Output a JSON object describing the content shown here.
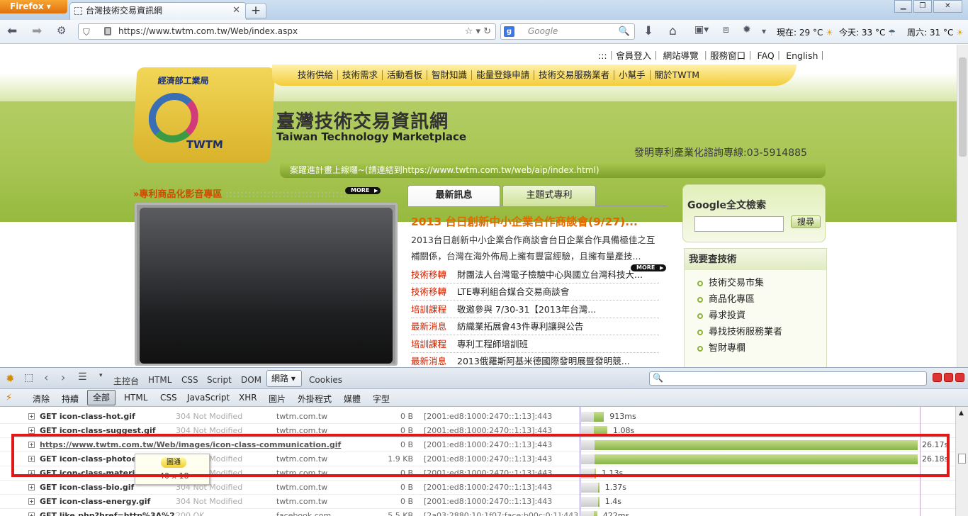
{
  "browser": {
    "firefox_label": "Firefox",
    "tab_title": "台灣技術交易資訊網",
    "url": "https://www.twtm.com.tw/Web/index.aspx",
    "search_placeholder": "Google",
    "weather_now": "現在: 29 °C",
    "weather_today": "今天: 33 °C",
    "weather_sat": "周六: 31 °C"
  },
  "site": {
    "top_links": ":::｜會員登入｜ 網站導覽 ｜服務窗口｜ FAQ｜ English｜",
    "ministry": "經濟部工業局",
    "logo_text": "TWTM",
    "menu": [
      "技術供給",
      "技術需求",
      "活動看板",
      "智財知識",
      "能量登錄申請",
      "技術交易服務業者",
      "小幫手",
      "關於TWTM"
    ],
    "title": "臺灣技術交易資訊網",
    "subtitle": "Taiwan Technology Marketplace",
    "hotline": "發明專利產業化諮詢專線:03-5914885",
    "marquee": "案躍進計畫上線囉~(請連結到https://www.twtm.com.tw/web/aip/index.html)",
    "video_title": "»專利商品化影音專區",
    "more": "MORE",
    "tabs": [
      "最新訊息",
      "主題式專利"
    ],
    "headline": "2013 台日創新中小企業合作商談會(9/27)...",
    "summary": "2013台日創新中小企業合作商談會台日企業合作具備極佳之互補關係，台灣在海外佈局上擁有豐富經驗，且擁有量產技...",
    "news": [
      {
        "cat": "技術移轉",
        "title": "財團法人台灣電子檢驗中心與國立台灣科技大..."
      },
      {
        "cat": "技術移轉",
        "title": "LTE專利組合媒合交易商談會"
      },
      {
        "cat": "培訓課程",
        "title": "敬邀參與 7/30-31【2013年台灣..."
      },
      {
        "cat": "最新消息",
        "title": "紡織業拓展會43件專利讓與公告"
      },
      {
        "cat": "培訓課程",
        "title": "專利工程師培訓班"
      },
      {
        "cat": "最新消息",
        "title": "2013俄羅斯阿基米德國際發明展暨發明競..."
      }
    ],
    "google_title": "Google全文檢索",
    "search_button": "搜尋",
    "find_tech_title": "我要查技術",
    "find_tech_items": [
      "技術交易市集",
      "商品化專區",
      "尋求投資",
      "尋找技術服務業者",
      "智財專欄"
    ]
  },
  "firebug": {
    "panels": [
      "主控台",
      "HTML",
      "CSS",
      "Script",
      "DOM",
      "網路",
      "Cookies"
    ],
    "filters": [
      "清除",
      "持續",
      "全部",
      "HTML",
      "CSS",
      "JavaScript",
      "XHR",
      "圖片",
      "外掛程式",
      "媒體",
      "字型"
    ],
    "requests": [
      {
        "name": "GET icon-class-hot.gif",
        "status": "304 Not Modified",
        "domain": "twtm.com.tw",
        "size": "0 B",
        "ip": "[2001:ed8:1000:2470::1:13]:443",
        "time": "913ms",
        "start": 0.0,
        "wait": 0.0,
        "len": 0.03
      },
      {
        "name": "GET icon-class-suggest.gif",
        "status": "304 Not Modified",
        "domain": "twtm.com.tw",
        "size": "0 B",
        "ip": "[2001:ed8:1000:2470::1:13]:443",
        "time": "1.08s",
        "start": 0.0,
        "wait": 0.0,
        "len": 0.04
      },
      {
        "name": "https://www.twtm.com.tw/Web/images/icon-class-communication.gif",
        "status": "",
        "domain": "",
        "size": "0 B",
        "ip": "[2001:ed8:1000:2470::1:13]:443",
        "time": "26.17s",
        "start": 0.0,
        "wait": 0.04,
        "len": 0.96,
        "highlight": true
      },
      {
        "name": "GET icon-class-photoele",
        "status": "304 Not Modified",
        "domain": "twtm.com.tw",
        "size": "1.9 KB",
        "ip": "[2001:ed8:1000:2470::1:13]:443",
        "time": "26.18s",
        "start": 0.0,
        "wait": 0.04,
        "len": 0.96
      },
      {
        "name": "GET icon-class-material",
        "status": "304 Not Modified",
        "domain": "twtm.com.tw",
        "size": "0 B",
        "ip": "[2001:ed8:1000:2470::1:13]:443",
        "time": "1.13s",
        "start": 0.0,
        "wait": 0.04,
        "len": 0.0
      },
      {
        "name": "GET icon-class-bio.gif",
        "status": "304 Not Modified",
        "domain": "twtm.com.tw",
        "size": "0 B",
        "ip": "[2001:ed8:1000:2470::1:13]:443",
        "time": "1.37s",
        "start": 0.0,
        "wait": 0.05,
        "len": 0.0
      },
      {
        "name": "GET icon-class-energy.gif",
        "status": "304 Not Modified",
        "domain": "twtm.com.tw",
        "size": "0 B",
        "ip": "[2001:ed8:1000:2470::1:13]:443",
        "time": "1.4s",
        "start": 0.0,
        "wait": 0.05,
        "len": 0.0
      },
      {
        "name": "GET like.php?href=http%3A%2",
        "status": "200 OK",
        "domain": "facebook.com",
        "size": "5.5 KB",
        "ip": "[2a03:2880:10:1f07:face:b00c:0:1]:443",
        "time": "422ms",
        "start": 0.0,
        "wait": 0.0,
        "len": 0.01
      }
    ],
    "tooltip_badge": "圖通",
    "tooltip_dim": "40 x 18"
  }
}
